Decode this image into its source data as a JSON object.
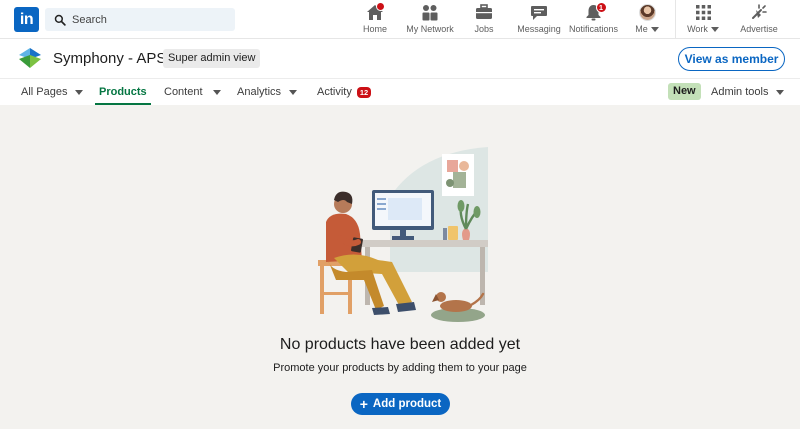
{
  "global_nav": {
    "logo_text": "in",
    "search": {
      "placeholder": "Search",
      "value": ""
    },
    "items": [
      {
        "label": "Home",
        "icon": "home-icon",
        "badge": "dot"
      },
      {
        "label": "My Network",
        "icon": "network-icon"
      },
      {
        "label": "Jobs",
        "icon": "briefcase-icon"
      },
      {
        "label": "Messaging",
        "icon": "messaging-icon"
      },
      {
        "label": "Notifications",
        "icon": "bell-icon",
        "badge": "1"
      },
      {
        "label": "Me",
        "icon": "avatar"
      },
      {
        "label": "Work",
        "icon": "grid-icon"
      },
      {
        "label": "Advertise",
        "icon": "advertise-icon"
      }
    ]
  },
  "page_header": {
    "company_name": "Symphony - APS",
    "admin_badge": "Super admin view",
    "view_as_member": "View as member"
  },
  "tabs": [
    {
      "label": "All Pages",
      "dropdown": true
    },
    {
      "label": "Products",
      "active": true
    },
    {
      "label": "Content",
      "dropdown": true
    },
    {
      "label": "Analytics",
      "dropdown": true
    },
    {
      "label": "Activity",
      "badge": "12"
    }
  ],
  "admin_tools": {
    "new_badge": "New",
    "label": "Admin tools"
  },
  "empty_state": {
    "title": "No products have been added yet",
    "description": "Promote your products by adding them to your page",
    "button_label": "Add product"
  },
  "colors": {
    "brand": "#0a66c2",
    "active_tab": "#057642",
    "badge": "#cc1016",
    "background": "#f3f2ef",
    "new_badge": "#c3e0b8"
  }
}
